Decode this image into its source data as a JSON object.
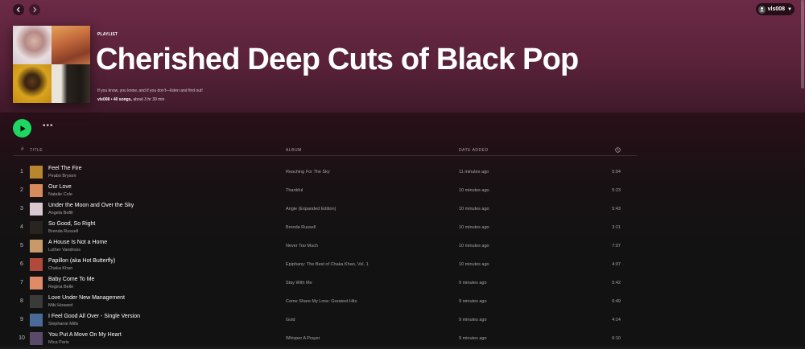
{
  "header": {
    "user": "vls008"
  },
  "playlist": {
    "type_label": "PLAYLIST",
    "title": "Cherished Deep Cuts of Black Pop",
    "description": "If you know, you know, and if you don't—listen and find out!",
    "owner": "vls008",
    "song_count": "40 songs,",
    "duration": "about 3 hr 30 min",
    "separator": "•"
  },
  "actions": {
    "more": "•••"
  },
  "table": {
    "headers": {
      "hash": "#",
      "title": "TITLE",
      "album": "ALBUM",
      "date_added": "DATE ADDED"
    },
    "rows": [
      {
        "num": "1",
        "title": "Feel The Fire",
        "artist": "Peabo Bryson",
        "album": "Reaching For The Sky",
        "added": "11 minutes ago",
        "duration": "5:04",
        "thumb": "#b8862e"
      },
      {
        "num": "2",
        "title": "Our Love",
        "artist": "Natalie Cole",
        "album": "Thankful",
        "added": "10 minutes ago",
        "duration": "5:23",
        "thumb": "#d98a5a"
      },
      {
        "num": "3",
        "title": "Under the Moon and Over the Sky",
        "artist": "Angela Bofill",
        "album": "Angie (Expanded Edition)",
        "added": "10 minutes ago",
        "duration": "5:43",
        "thumb": "#d8c8d0"
      },
      {
        "num": "4",
        "title": "So Good, So Right",
        "artist": "Brenda Russell",
        "album": "Brenda Russell",
        "added": "10 minutes ago",
        "duration": "3:21",
        "thumb": "#2a2420"
      },
      {
        "num": "5",
        "title": "A House Is Not a Home",
        "artist": "Luther Vandross",
        "album": "Never Too Much",
        "added": "10 minutes ago",
        "duration": "7:07",
        "thumb": "#c89a6a"
      },
      {
        "num": "6",
        "title": "Papillon (aka Hot Butterfly)",
        "artist": "Chaka Khan",
        "album": "Epiphany: The Best of Chaka Khan, Vol. 1",
        "added": "10 minutes ago",
        "duration": "4:07",
        "thumb": "#b04a3a"
      },
      {
        "num": "7",
        "title": "Baby Come To Me",
        "artist": "Regina Belle",
        "album": "Stay With Me",
        "added": "9 minutes ago",
        "duration": "5:42",
        "thumb": "#e08a6a"
      },
      {
        "num": "8",
        "title": "Love Under New Management",
        "artist": "Miki Howard",
        "album": "Come Share My Love: Greatest Hits",
        "added": "9 minutes ago",
        "duration": "6:49",
        "thumb": "#3a3a3a"
      },
      {
        "num": "9",
        "title": "I Feel Good All Over - Single Version",
        "artist": "Stephanie Mills",
        "album": "Gold",
        "added": "9 minutes ago",
        "duration": "4:14",
        "thumb": "#4a6a9a"
      },
      {
        "num": "10",
        "title": "You Put A Move On My Heart",
        "artist": "Mica Paris",
        "album": "Whisper A Prayer",
        "added": "9 minutes ago",
        "duration": "6:10",
        "thumb": "#5a4a6a"
      }
    ]
  },
  "colors": {
    "accent": "#1ed760",
    "hero": "#6b2a46",
    "background": "#121212"
  }
}
